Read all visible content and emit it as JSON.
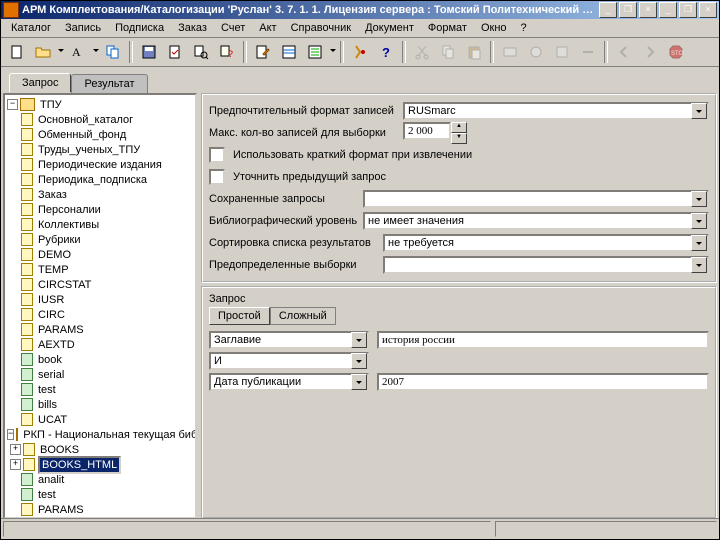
{
  "titlebar": {
    "title": "АРМ Комплектования/Каталогизации 'Руслан' 3. 7. 1. 1. Лицензия сервера : Томский Политехнический Университет - [Запись: п…"
  },
  "menu": {
    "items": [
      "Каталог",
      "Запись",
      "Подписка",
      "Заказ",
      "Счет",
      "Акт",
      "Справочник",
      "Документ",
      "Формат",
      "Окно",
      "?"
    ]
  },
  "tabs": {
    "request": "Запрос",
    "result": "Результат"
  },
  "tree": {
    "root1": "ТПУ",
    "items1": [
      "Основной_каталог",
      "Обменный_фонд",
      "Труды_ученых_ТПУ",
      "Периодические издания",
      "Периодика_подписка",
      "Заказ",
      "Персоналии",
      "Коллективы",
      "Рубрики",
      "DEMO",
      "TEMP",
      "CIRCSTAT",
      "IUSR",
      "CIRC",
      "PARAMS",
      "AEXTD",
      "book",
      "serial",
      "test",
      "bills",
      "UCAT"
    ],
    "root2": "РКП - Национальная текущая библиогр",
    "items2": [
      "BOOKS",
      "BOOKS_HTML",
      "analit",
      "test",
      "PARAMS"
    ]
  },
  "form": {
    "pref_format_label": "Предпочтительный формат записей",
    "pref_format_value": "RUSmarc",
    "max_records_label": "Макс. кол-во записей для выборки",
    "max_records_value": "2 000",
    "short_format": "Использовать краткий формат при извлечении",
    "refine_prev": "Уточнить предыдущий запрос",
    "saved_queries": "Сохраненные запросы",
    "biblio_level_label": "Библиографический уровень",
    "biblio_level_value": "не имеет значения",
    "sort_label": "Сортировка списка результатов",
    "sort_value": "не требуется",
    "predef_label": "Предопределенные выборки"
  },
  "query": {
    "header": "Запрос",
    "tab_simple": "Простой",
    "tab_complex": "Сложный",
    "field1": "Заглавие",
    "value1": "история россии",
    "op": "И",
    "field2": "Дата публикации",
    "value2": "2007"
  }
}
